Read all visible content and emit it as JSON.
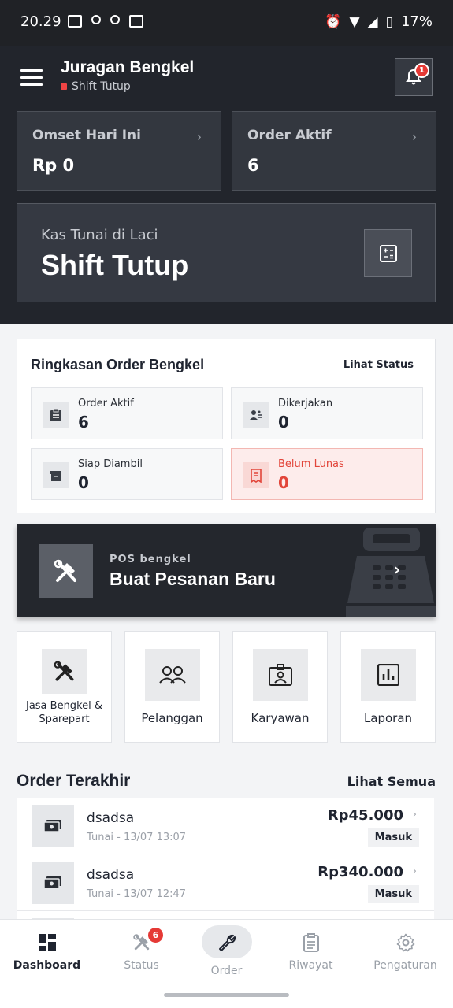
{
  "status_bar": {
    "time": "20.29",
    "battery": "17%"
  },
  "header": {
    "title": "Juragan Bengkel",
    "shift_status": "Shift Tutup",
    "notification_count": "1"
  },
  "stats": [
    {
      "label": "Omset Hari Ini",
      "value": "Rp 0"
    },
    {
      "label": "Order Aktif",
      "value": "6"
    }
  ],
  "cash": {
    "label": "Kas Tunai di Laci",
    "value": "Shift Tutup"
  },
  "summary": {
    "title": "Ringkasan Order Bengkel",
    "link": "Lihat Status",
    "items": [
      {
        "label": "Order Aktif",
        "value": "6",
        "icon": "clipboard-icon"
      },
      {
        "label": "Dikerjakan",
        "value": "0",
        "icon": "workers-icon"
      },
      {
        "label": "Siap Diambil",
        "value": "0",
        "icon": "box-icon"
      },
      {
        "label": "Belum Lunas",
        "value": "0",
        "icon": "receipt-icon"
      }
    ]
  },
  "pos": {
    "subtitle": "POS bengkel",
    "title": "Buat Pesanan Baru"
  },
  "quick_menu": [
    {
      "label": "Jasa Bengkel & Sparepart",
      "icon": "tools-icon"
    },
    {
      "label": "Pelanggan",
      "icon": "users-icon"
    },
    {
      "label": "Karyawan",
      "icon": "id-card-icon"
    },
    {
      "label": "Laporan",
      "icon": "report-chart-icon"
    }
  ],
  "recent": {
    "title": "Order Terakhir",
    "link": "Lihat Semua",
    "orders": [
      {
        "name": "dsadsa",
        "meta": "Tunai - 13/07 13:07",
        "amount": "Rp45.000",
        "badge": "Masuk"
      },
      {
        "name": "dsadsa",
        "meta": "Tunai - 13/07 12:47",
        "amount": "Rp340.000",
        "badge": "Masuk"
      }
    ]
  },
  "bottom_nav": [
    {
      "label": "Dashboard",
      "icon": "dashboard-icon"
    },
    {
      "label": "Status",
      "icon": "tools-icon",
      "badge": "6"
    },
    {
      "label": "Order",
      "icon": "wrench-icon"
    },
    {
      "label": "Riwayat",
      "icon": "history-icon"
    },
    {
      "label": "Pengaturan",
      "icon": "gear-icon"
    }
  ],
  "colors": {
    "header_bg": "#22252c",
    "danger": "#e53935",
    "page_bg": "#f3f4f6"
  }
}
